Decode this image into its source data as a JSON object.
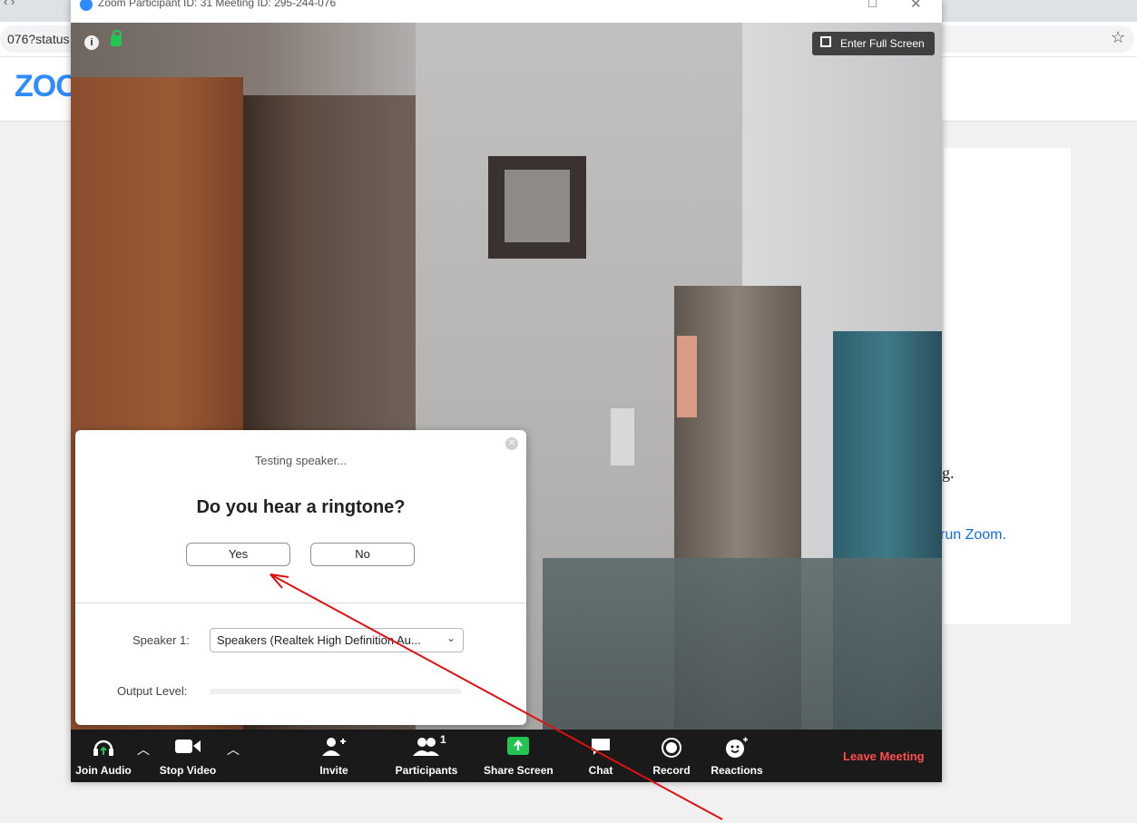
{
  "browser": {
    "address_fragment": "076?status",
    "logo": "ZOO",
    "card_text": "g.",
    "card_link": "run Zoom."
  },
  "zoom_window": {
    "title": "Zoom Participant ID: 31   Meeting ID: 295-244-076",
    "enter_full_screen": "Enter Full Screen"
  },
  "dialog": {
    "status": "Testing speaker...",
    "question": "Do you hear a ringtone?",
    "yes_label": "Yes",
    "no_label": "No",
    "speaker_label": "Speaker 1:",
    "speaker_value": "Speakers (Realtek High Definition Au...",
    "output_label": "Output Level:",
    "output_level": 0
  },
  "toolbar": {
    "join_audio": "Join Audio",
    "stop_video": "Stop Video",
    "invite": "Invite",
    "participants": "Participants",
    "participants_count": "1",
    "share_screen": "Share Screen",
    "chat": "Chat",
    "record": "Record",
    "reactions": "Reactions",
    "leave_meeting": "Leave Meeting"
  },
  "colors": {
    "accent": "#2d8cff",
    "share_green": "#23c552",
    "leave_red": "#ff4e4e",
    "annotation_red": "#e01010"
  }
}
